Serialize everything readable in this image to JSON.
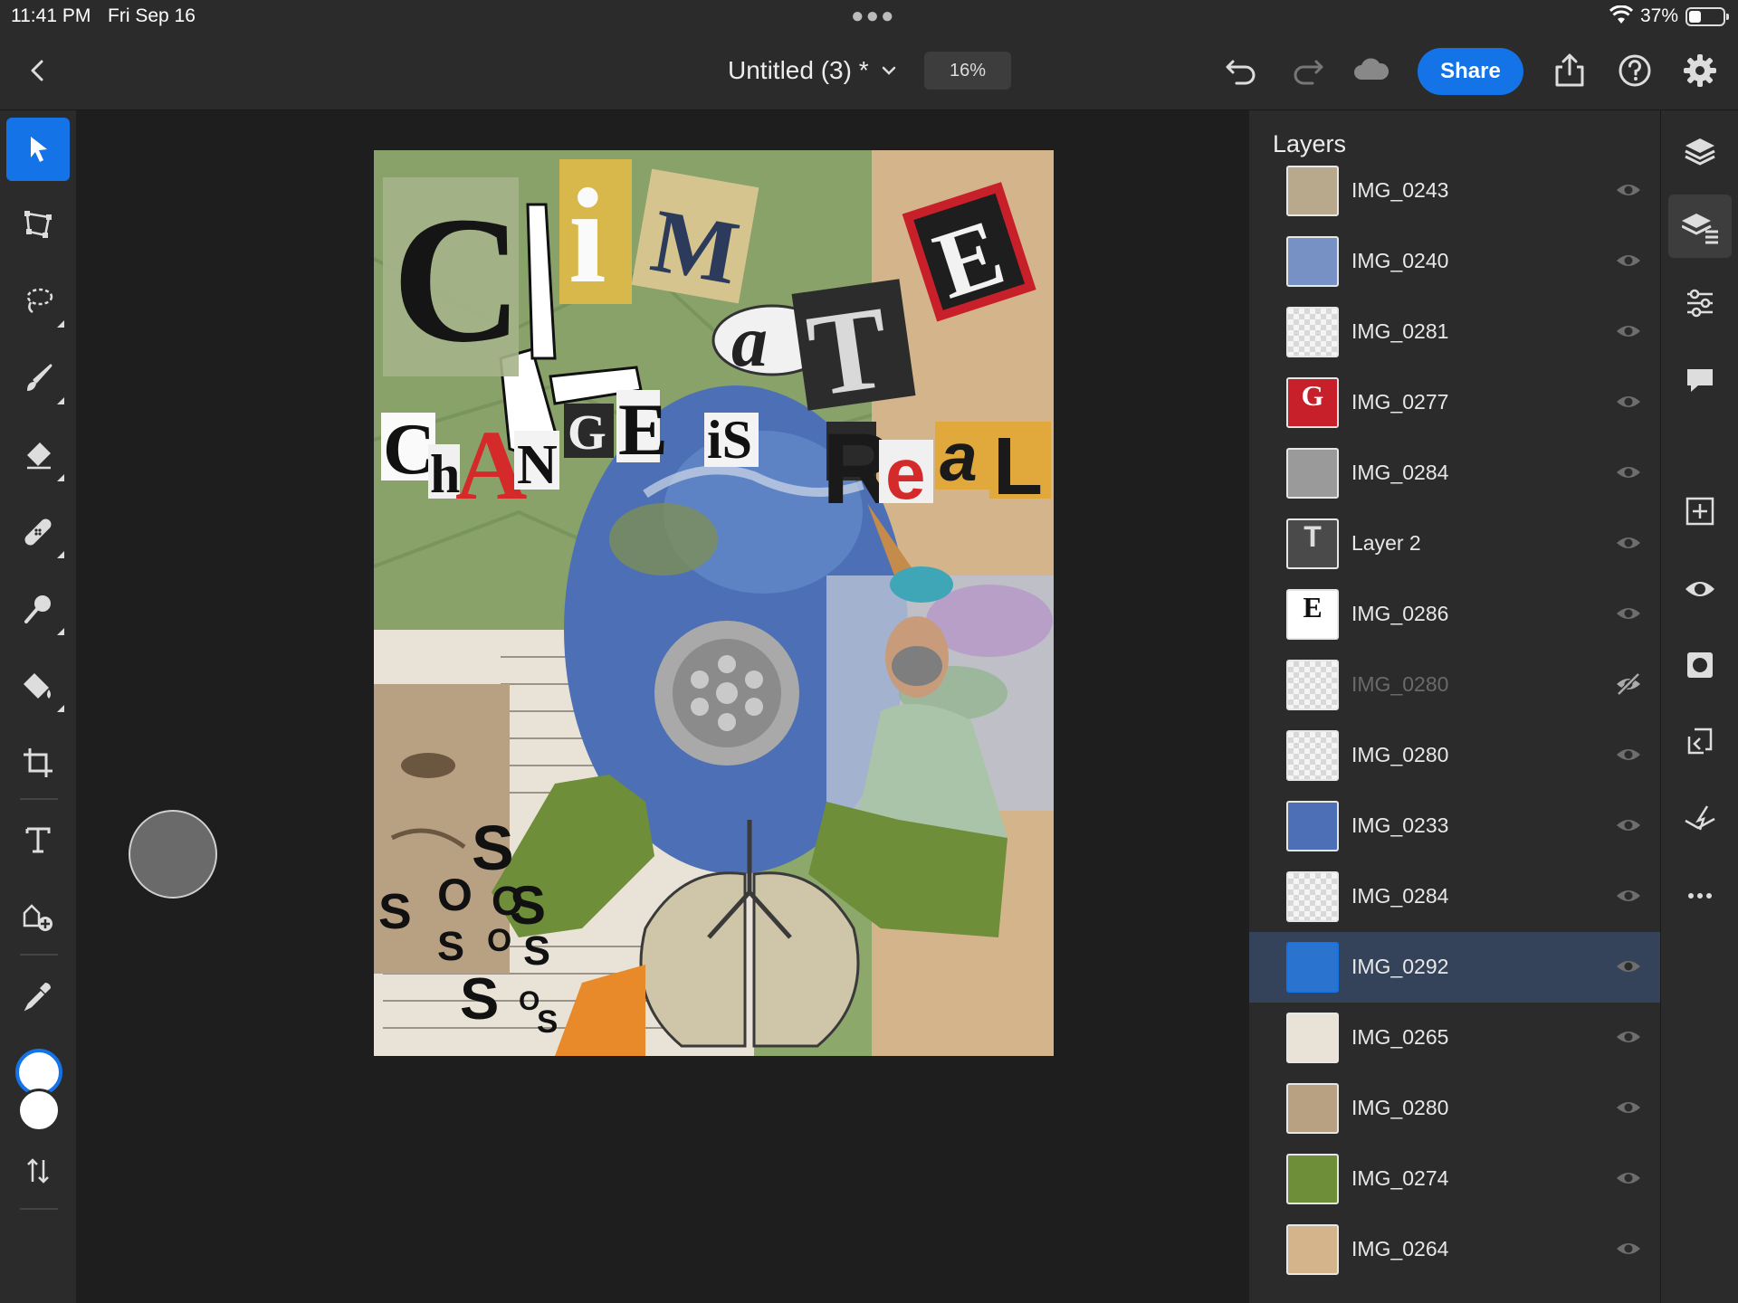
{
  "status": {
    "time": "11:41 PM",
    "date": "Fri Sep 16",
    "battery_percent": "37%",
    "battery_level": 0.37
  },
  "toolbar": {
    "doc_title": "Untitled (3) *",
    "zoom": "16%",
    "share_label": "Share",
    "accent": "#1473e6"
  },
  "artwork": {
    "word_climate": [
      "C",
      "i",
      "M",
      "a",
      "T",
      "E"
    ],
    "word_change": [
      "C",
      "h",
      "A",
      "N",
      "G",
      "E"
    ],
    "word_is": "iS",
    "word_real": [
      "R",
      "e",
      "a",
      "L"
    ],
    "sos_letters": [
      "S",
      "O",
      "S",
      "O",
      "S",
      "S",
      "O",
      "S",
      "S",
      "O",
      "S"
    ]
  },
  "layers": {
    "title": "Layers",
    "items": [
      {
        "name": "IMG_0243",
        "visible": true
      },
      {
        "name": "IMG_0240",
        "visible": true
      },
      {
        "name": "IMG_0281",
        "visible": true
      },
      {
        "name": "IMG_0277",
        "visible": true,
        "glyph": "G"
      },
      {
        "name": "IMG_0284",
        "visible": true
      },
      {
        "name": "Layer 2",
        "visible": true,
        "glyph": "T"
      },
      {
        "name": "IMG_0286",
        "visible": true,
        "glyph": "E"
      },
      {
        "name": "IMG_0280",
        "visible": false
      },
      {
        "name": "IMG_0280",
        "visible": true
      },
      {
        "name": "IMG_0233",
        "visible": true
      },
      {
        "name": "IMG_0284",
        "visible": true
      },
      {
        "name": "IMG_0292",
        "visible": true,
        "selected": true
      },
      {
        "name": "IMG_0265",
        "visible": true
      },
      {
        "name": "IMG_0280",
        "visible": true
      },
      {
        "name": "IMG_0274",
        "visible": true
      },
      {
        "name": "IMG_0264",
        "visible": true
      }
    ]
  }
}
